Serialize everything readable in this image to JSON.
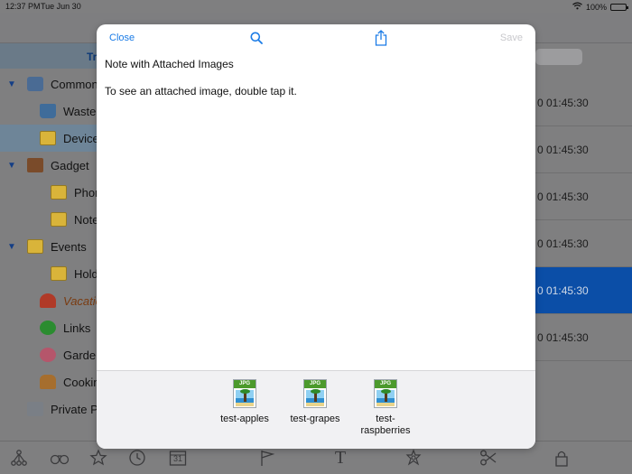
{
  "status": {
    "time": "12:37 PM",
    "date": "Tue Jun 30",
    "battery": "100%",
    "battery_level": 1.0
  },
  "sidebar": {
    "tab_label": "Tr",
    "items": [
      {
        "label": "Common",
        "indent": 0,
        "expanded": true,
        "icon": "stack-icon",
        "cls": "common"
      },
      {
        "label": "Wasteb",
        "indent": 1,
        "icon": "trash-icon",
        "cls": "waste"
      },
      {
        "label": "Device",
        "indent": 1,
        "icon": "folder-icon",
        "cls": "folder",
        "selected": true
      },
      {
        "label": "Gadget",
        "indent": 0,
        "expanded": true,
        "icon": "speaker-icon",
        "cls": "gadget"
      },
      {
        "label": "Phon",
        "indent": 2,
        "icon": "folder-icon",
        "cls": "folder"
      },
      {
        "label": "Notel",
        "indent": 2,
        "icon": "folder-icon",
        "cls": "folder"
      },
      {
        "label": "Events",
        "indent": 0,
        "expanded": true,
        "icon": "folder-icon",
        "cls": "folder"
      },
      {
        "label": "Holda",
        "indent": 2,
        "icon": "folder-icon",
        "cls": "folder"
      },
      {
        "label": "Vacatio",
        "indent": 1,
        "icon": "umbrella-icon",
        "cls": "vac",
        "italic": true
      },
      {
        "label": "Links",
        "indent": 1,
        "icon": "globe-icon",
        "cls": "links"
      },
      {
        "label": "Garden",
        "indent": 1,
        "icon": "flower-icon",
        "cls": "garden"
      },
      {
        "label": "Cooking",
        "indent": 1,
        "icon": "burger-icon",
        "cls": "cook"
      },
      {
        "label": "Private Pa",
        "indent": 0,
        "icon": "lock-icon",
        "cls": "lock"
      }
    ]
  },
  "list": {
    "rows": [
      {
        "time": "0  01:45:30"
      },
      {
        "time": "0  01:45:30"
      },
      {
        "time": "0  01:45:30"
      },
      {
        "time": "0  01:45:30"
      },
      {
        "time": "0  01:45:30",
        "selected": true
      },
      {
        "time": "0  01:45:30"
      }
    ]
  },
  "modal": {
    "close_label": "Close",
    "save_label": "Save",
    "title": "Note with Attached Images",
    "body": "To see an attached image, double tap it.",
    "attachments": [
      {
        "name": "test-apples",
        "type": "JPG"
      },
      {
        "name": "test-grapes",
        "type": "JPG"
      },
      {
        "name": "test-\nraspberries",
        "type": "JPG"
      }
    ]
  },
  "bottom_bar": {
    "icons": [
      "tree-icon",
      "binoculars-icon",
      "star-icon",
      "clock-icon",
      "calendar-icon",
      "flag-icon",
      "text-icon",
      "flower-badge-icon",
      "scissors-icon",
      "lock-icon"
    ],
    "calendar_day": "31",
    "text_glyph": "T"
  },
  "colors": {
    "accent": "#1a7be6",
    "selection": "#0b4ea7"
  }
}
